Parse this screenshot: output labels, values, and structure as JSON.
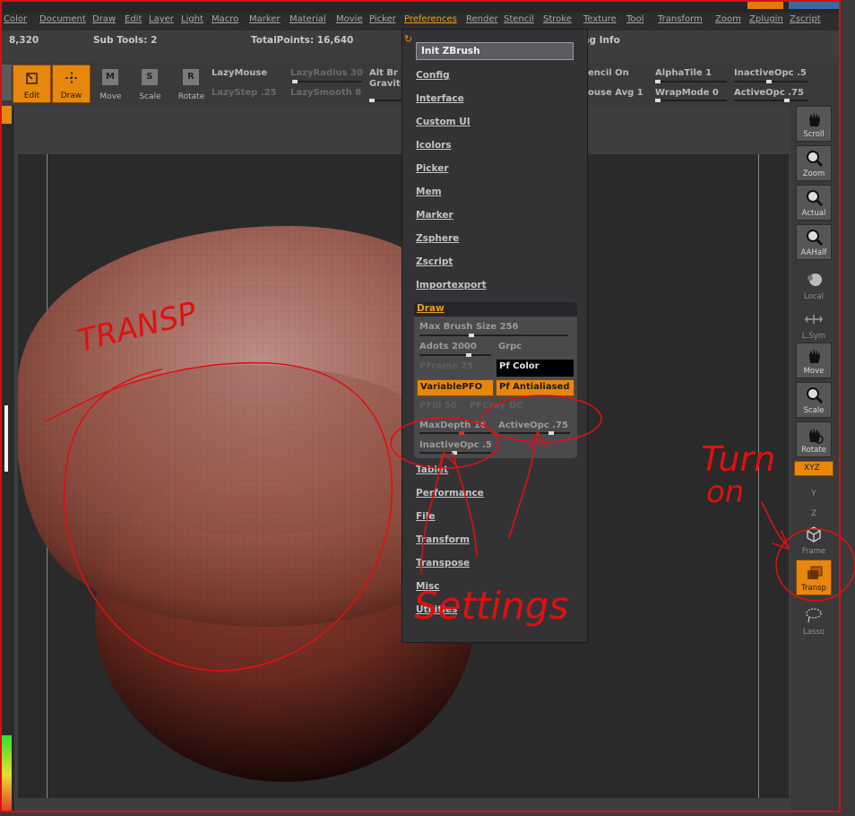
{
  "menu": {
    "items": [
      "Color",
      "Document",
      "Draw",
      "Edit",
      "Layer",
      "Light",
      "Macro",
      "Marker",
      "Material",
      "Movie",
      "Picker",
      "Preferences",
      "Render",
      "Stencil",
      "Stroke",
      "Texture",
      "Tool",
      "Transform",
      "Zoom",
      "Zplugin",
      "Zscript"
    ],
    "active": "Preferences"
  },
  "info": {
    "points": "8,320",
    "subtools": "Sub Tools: 2",
    "totalpoints": "TotalPoints: 16,640",
    "right": "ng Info"
  },
  "toolbar": {
    "edit": "Edit",
    "draw": "Draw",
    "move": "Move",
    "scale": "Scale",
    "rotate": "Rotate",
    "lazymouse": "LazyMouse",
    "lazyradius": "LazyRadius 30",
    "lazystep": "LazyStep .25",
    "lazysmooth": "LazySmooth 8",
    "altbr": "Alt Br",
    "gravit": "Gravit",
    "stencilon": "encil On",
    "mouseavg": "ouse Avg 1",
    "alphatile": "AlphaTile 1",
    "wrapmode": "WrapMode 0",
    "inactiveopc": "InactiveOpc .5",
    "activeopc": "ActiveOpc .75"
  },
  "right_tray": {
    "scroll": "Scroll",
    "zoom": "Zoom",
    "actual": "Actual",
    "aahalf": "AAHalf",
    "local": "Local",
    "lsym": "L.Sym",
    "move": "Move",
    "scale": "Scale",
    "rotate": "Rotate",
    "xyz": "XYZ",
    "y": "Y",
    "z": "Z",
    "frame": "Frame",
    "transp": "Transp",
    "lasso": "Lasso"
  },
  "dropdown": {
    "init": "Init ZBrush",
    "items_top": [
      "Config",
      "Interface",
      "Custom UI",
      "Icolors",
      "Picker",
      "Mem",
      "Marker",
      "Zsphere",
      "Zscript",
      "Importexport"
    ],
    "draw_panel": {
      "title": "Draw",
      "max_brush_size": "Max Brush Size 256",
      "adots": "Adots 2000",
      "grpc": "Grpc",
      "pframe": "PFrame 25",
      "pf_color": "Pf Color",
      "variablepfo": "VariablePFO",
      "pf_antialiased": "Pf Antialiased",
      "pfill": "PFill 50",
      "pfcray": "PFCray",
      "dc": "DC",
      "maxdepth": "MaxDepth 16",
      "activeopc": "ActiveOpc .75",
      "inactiveopc": "InactiveOpc .5"
    },
    "items_bottom": [
      "Tablet",
      "Performance",
      "File",
      "Transform",
      "Transpose",
      "Misc",
      "Utilities"
    ]
  },
  "annotations": {
    "transp": "TRANSP",
    "settings": "Settings",
    "turn": "Turn",
    "on": "on"
  },
  "colors": {
    "accent": "#e8870e",
    "ink": "#e01010",
    "model": "#a04a38"
  }
}
